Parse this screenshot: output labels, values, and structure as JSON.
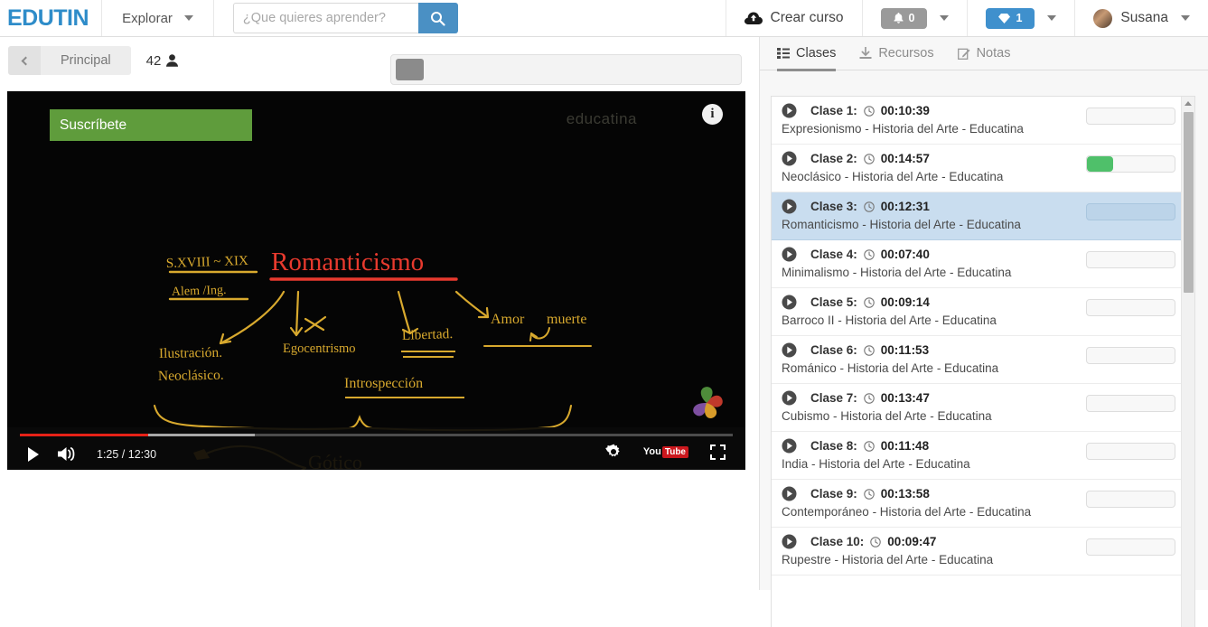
{
  "navbar": {
    "brand": "EDUTIN",
    "explore_label": "Explorar",
    "search": {
      "placeholder": "¿Que quieres aprender?",
      "value": "",
      "icon": "search-icon"
    },
    "create_course_label": "Crear curso",
    "create_course_icon": "cloud-upload-icon",
    "notifications": {
      "icon": "bell-icon",
      "count": "0",
      "color": "#9a9a9a"
    },
    "credits": {
      "icon": "diamond-icon",
      "count": "1",
      "color": "#3f90cd"
    },
    "user": {
      "name": "Susana",
      "icon": "avatar"
    },
    "accent_color": "#2e8cc9"
  },
  "subbar": {
    "back_icon": "chevron-left-icon",
    "breadcrumb_label": "Principal",
    "view_count": "42",
    "view_icon": "user-icon"
  },
  "player": {
    "overlay_banner": "Suscríbete",
    "overlay_color": "#5f9c3c",
    "watermark": "educatina",
    "info_icon": "info-icon",
    "brand_logo_icon": "pinwheel-logo-icon",
    "controls": {
      "play_icon": "play-icon",
      "volume_icon": "volume-icon",
      "time": "1:25 / 12:30",
      "current_time": "1:25",
      "duration": "12:30",
      "settings_icon": "gear-icon",
      "youtube_label_pre": "You",
      "youtube_label_post": "Tube",
      "fullscreen_icon": "fullscreen-icon",
      "progress_played_pct": 18,
      "progress_buffered_pct": 33,
      "progress_color": "#e62117"
    },
    "whiteboard": {
      "title": "Romanticismo",
      "title_color": "#e83a2e",
      "ink_color": "#e0a92c",
      "notes": [
        "S.XVIII ~ XIX",
        "Alem /Ing.",
        "Ilustración.",
        "Neoclásico.",
        "Egocentrismo",
        "Libertad.",
        "Introspección",
        "Amor  muerte",
        "Gótico"
      ]
    }
  },
  "right_panel": {
    "tabs": [
      {
        "label": "Clases",
        "icon": "list-icon",
        "active": true
      },
      {
        "label": "Recursos",
        "icon": "download-icon",
        "active": false
      },
      {
        "label": "Notas",
        "icon": "edit-icon",
        "active": false
      }
    ],
    "classes": [
      {
        "label": "Clase 1:",
        "duration": "00:10:39",
        "title": "Expresionismo - Historia del Arte - Educatina",
        "progress": 0,
        "selected": false
      },
      {
        "label": "Clase 2:",
        "duration": "00:14:57",
        "title": "Neoclásico - Historia del Arte - Educatina",
        "progress": 30,
        "selected": false
      },
      {
        "label": "Clase 3:",
        "duration": "00:12:31",
        "title": "Romanticismo - Historia del Arte - Educatina",
        "progress": 0,
        "selected": true
      },
      {
        "label": "Clase 4:",
        "duration": "00:07:40",
        "title": "Minimalismo - Historia del Arte - Educatina",
        "progress": 0,
        "selected": false
      },
      {
        "label": "Clase 5:",
        "duration": "00:09:14",
        "title": "Barroco II - Historia del Arte - Educatina",
        "progress": 0,
        "selected": false
      },
      {
        "label": "Clase 6:",
        "duration": "00:11:53",
        "title": "Románico - Historia del Arte - Educatina",
        "progress": 0,
        "selected": false
      },
      {
        "label": "Clase 7:",
        "duration": "00:13:47",
        "title": "Cubismo - Historia del Arte - Educatina",
        "progress": 0,
        "selected": false
      },
      {
        "label": "Clase 8:",
        "duration": "00:11:48",
        "title": "India - Historia del Arte - Educatina",
        "progress": 0,
        "selected": false
      },
      {
        "label": "Clase 9:",
        "duration": "00:13:58",
        "title": "Contemporáneo - Historia del Arte - Educatina",
        "progress": 0,
        "selected": false
      },
      {
        "label": "Clase 10:",
        "duration": "00:09:47",
        "title": "Rupestre - Historia del Arte - Educatina",
        "progress": 0,
        "selected": false
      }
    ],
    "progress_fill_color": "#4fc06a",
    "selected_row_color": "#c9ddef"
  }
}
